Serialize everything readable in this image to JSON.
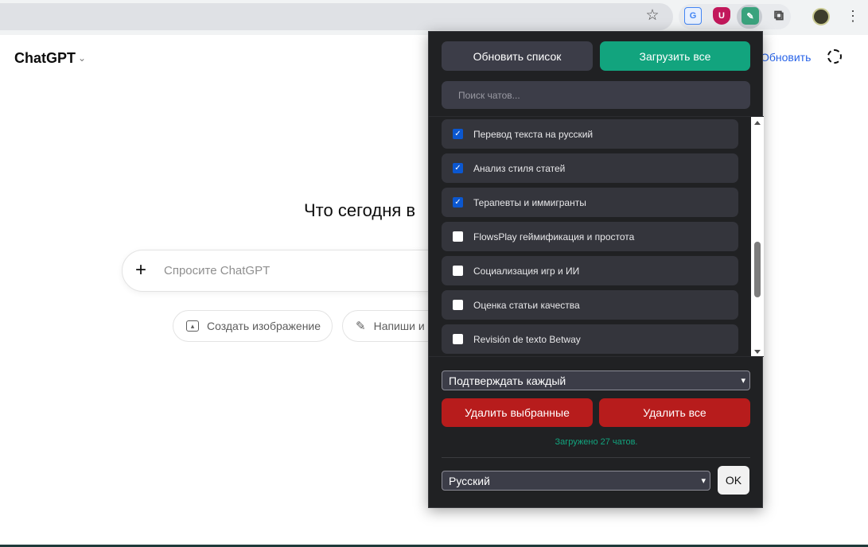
{
  "page": {
    "brand": "ChatGPT",
    "update_link": "Обновить",
    "hero_text": "Что сегодня в",
    "composer_placeholder": "Спросите ChatGPT",
    "suggestions": [
      "Создать изображение",
      "Напиши и"
    ]
  },
  "popup": {
    "refresh_label": "Обновить список",
    "load_all_label": "Загрузить все",
    "search_placeholder": "Поиск чатов...",
    "chats": [
      {
        "title": "Перевод текста на русский",
        "checked": true
      },
      {
        "title": "Анализ стиля статей",
        "checked": true
      },
      {
        "title": "Терапевты и иммигранты",
        "checked": true
      },
      {
        "title": "FlowsPlay геймификация и простота",
        "checked": false
      },
      {
        "title": "Социализация игр и ИИ",
        "checked": false
      },
      {
        "title": "Оценка статьи качества",
        "checked": false
      },
      {
        "title": "Revisión de texto Betway",
        "checked": false
      }
    ],
    "mode_select": "Подтверждать каждый",
    "delete_selected_label": "Удалить выбранные",
    "delete_all_label": "Удалить все",
    "status": "Загружено 27 чатов.",
    "language_select": "Русский",
    "ok_label": "OK",
    "colors": {
      "accent": "#12a47e",
      "danger": "#b71c1c",
      "panel": "#202123"
    }
  },
  "icons": [
    "star-icon",
    "translate-icon",
    "ublock-icon",
    "chat-cleaner-icon",
    "puzzle-icon",
    "kebab-menu-icon",
    "chevron-down-icon",
    "temporary-chat-icon",
    "plus-icon",
    "image-icon",
    "pencil-icon"
  ]
}
